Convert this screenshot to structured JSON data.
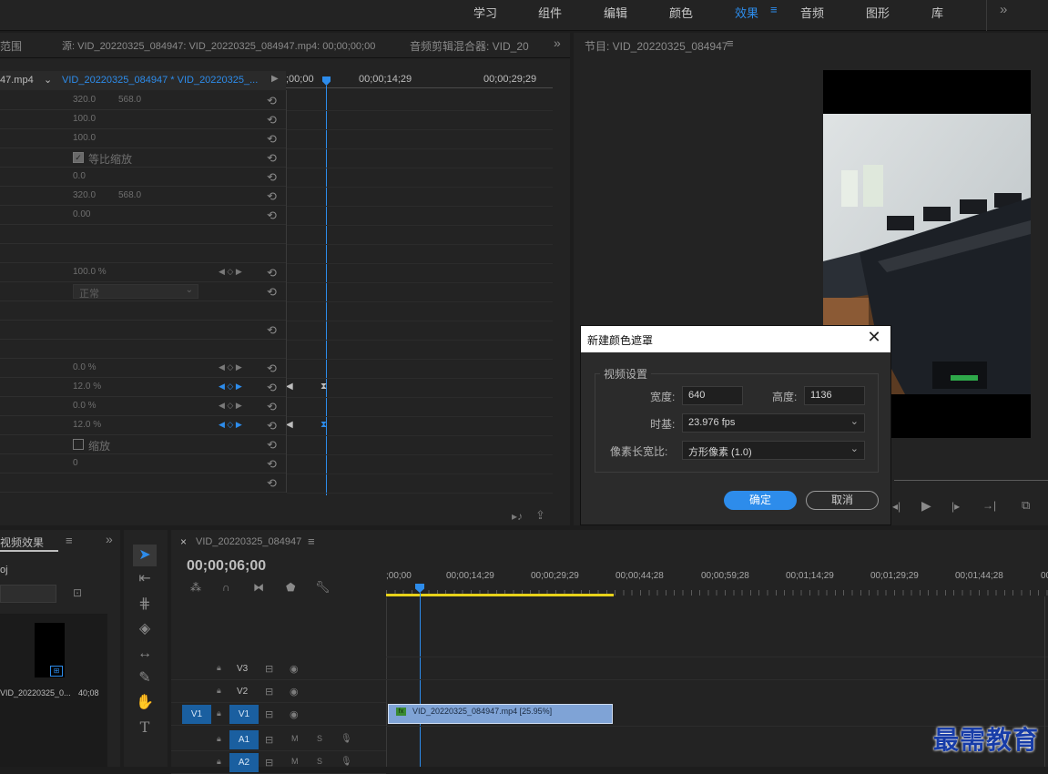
{
  "workspaces": {
    "tabs": [
      "学习",
      "组件",
      "编辑",
      "颜色",
      "效果",
      "音频",
      "图形",
      "库"
    ],
    "active": "效果",
    "overflow": "»"
  },
  "source_panel": {
    "tab_range": "范围",
    "tab_source": "源: VID_20220325_084947: VID_20220325_084947.mp4: 00;00;00;00",
    "tab_mixer": "音频剪辑混合器: VID_20",
    "clip_left": "47.mp4",
    "clip_right": "VID_20220325_084947 * VID_20220325_...",
    "ruler": [
      ";00;00",
      "00;00;14;29",
      "00;00;29;29"
    ],
    "rows": [
      {
        "v1": "320.0",
        "v2": "568.0"
      },
      {
        "v1": "100.0",
        "v2": ""
      },
      {
        "v1": "100.0",
        "v2": ""
      },
      {
        "v1": "等比缩放",
        "v2": ""
      },
      {
        "v1": "0.0",
        "v2": ""
      },
      {
        "v1": "320.0",
        "v2": "568.0"
      },
      {
        "v1": "0.00",
        "v2": ""
      },
      {
        "v1": "",
        "v2": ""
      },
      {
        "v1": "",
        "v2": ""
      },
      {
        "v1": "100.0 %",
        "v2": ""
      },
      {
        "v1": "正常",
        "v2": ""
      },
      {
        "v1": "",
        "v2": ""
      },
      {
        "v1": "",
        "v2": ""
      },
      {
        "v1": "",
        "v2": ""
      },
      {
        "v1": "0.0 %",
        "v2": ""
      },
      {
        "v1": "12.0 %",
        "v2": ""
      },
      {
        "v1": "0.0 %",
        "v2": ""
      },
      {
        "v1": "12.0 %",
        "v2": ""
      },
      {
        "v1": "缩放",
        "v2": ""
      },
      {
        "v1": "0",
        "v2": ""
      },
      {
        "v1": "",
        "v2": ""
      }
    ]
  },
  "program_panel": {
    "title": "节目: VID_20220325_084947"
  },
  "effects_panel": {
    "title": "视频效果",
    "item": "oj",
    "thumb_name": "VID_20220325_0...",
    "thumb_duration": "40;08"
  },
  "timeline": {
    "tab": "VID_20220325_084947",
    "timecode": "00;00;06;00",
    "ruler": [
      ";00;00",
      "00;00;14;29",
      "00;00;29;29",
      "00;00;44;28",
      "00;00;59;28",
      "00;01;14;29",
      "00;01;29;29",
      "00;01;44;28",
      "00;"
    ],
    "tracks": [
      {
        "src": "",
        "name": "V3"
      },
      {
        "src": "",
        "name": "V2"
      },
      {
        "src": "V1",
        "name": "V1"
      },
      {
        "src": "",
        "name": "A1"
      },
      {
        "src": "",
        "name": "A2"
      }
    ],
    "clip_label": "VID_20220325_084947.mp4 [25.95%]",
    "clip_fx": "fx",
    "mute_label": "M",
    "solo_label": "S"
  },
  "dialog": {
    "title": "新建颜色遮罩",
    "group": "视频设置",
    "width_label": "宽度:",
    "width_value": "640",
    "height_label": "高度:",
    "height_value": "1136",
    "timebase_label": "时基:",
    "timebase_value": "23.976 fps",
    "aspect_label": "像素长宽比:",
    "aspect_value": "方形像素 (1.0)",
    "ok": "确定",
    "cancel": "取消"
  },
  "watermark": "最需教育",
  "colors": {
    "accent": "#2d8ceb",
    "track_blue": "#1a5fa0",
    "clip": "#7fa3d6",
    "work_area": "#e8d21a"
  }
}
